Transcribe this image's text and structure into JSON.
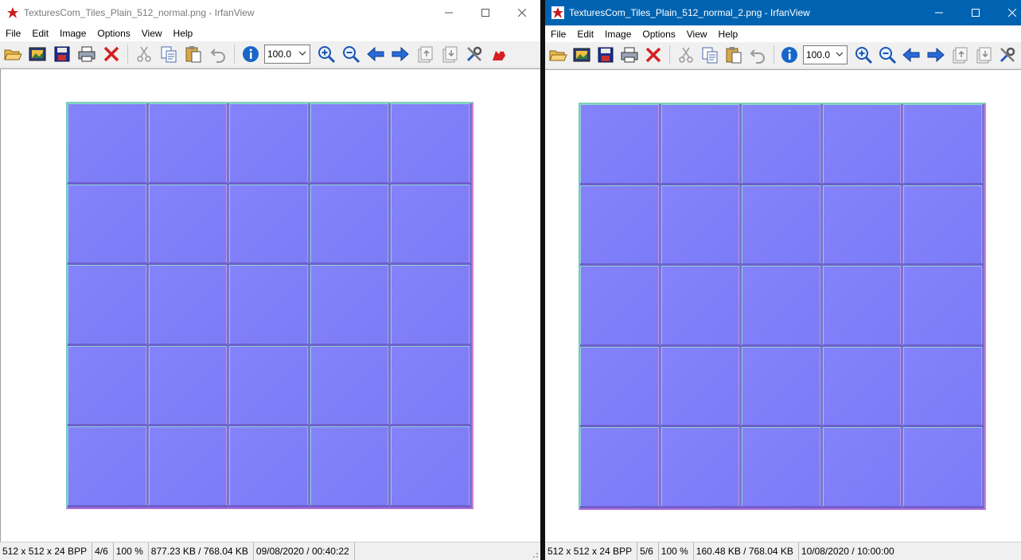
{
  "windows": [
    {
      "title": "TexturesCom_Tiles_Plain_512_normal.png - IrfanView",
      "active": false,
      "menu": [
        "File",
        "Edit",
        "Image",
        "Options",
        "View",
        "Help"
      ],
      "zoom_value": "100.0",
      "status": {
        "dimensions": "512 x 512 x 24 BPP",
        "index": "4/6",
        "zoom": "100 %",
        "size": "877.23 KB / 768.04 KB",
        "datetime": "09/08/2020 / 00:40:22"
      }
    },
    {
      "title": "TexturesCom_Tiles_Plain_512_normal_2.png - IrfanView",
      "active": true,
      "menu": [
        "File",
        "Edit",
        "Image",
        "Options",
        "View",
        "Help"
      ],
      "zoom_value": "100.0",
      "status": {
        "dimensions": "512 x 512 x 24 BPP",
        "index": "5/6",
        "zoom": "100 %",
        "size": "160.48 KB / 768.04 KB",
        "datetime": "10/08/2020 / 10:00:00"
      }
    }
  ],
  "toolbar_icons": [
    "open-folder-icon",
    "slideshow-icon",
    "save-icon",
    "print-icon",
    "delete-icon",
    "cut-icon",
    "copy-icon",
    "paste-icon",
    "undo-icon",
    "info-icon",
    "zoom-in-icon",
    "zoom-out-icon",
    "previous-icon",
    "next-icon",
    "first-page-icon",
    "last-page-icon",
    "settings-icon",
    "irfan-icon"
  ],
  "colors": {
    "active_title": "#0063b1",
    "normal_map_base": "#7f7ff8",
    "tile_edge_highlight": "#8fd4d2",
    "tile_edge_shadow": "#6f5fcc"
  },
  "texture": {
    "rows": 5,
    "cols": 5
  }
}
